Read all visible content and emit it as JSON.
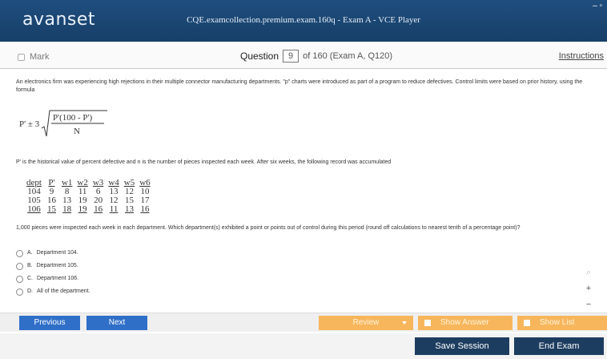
{
  "app": {
    "logo": "avanset",
    "window_title": "CQE.examcollection.premium.exam.160q - Exam A - VCE Player",
    "window_controls": "– ▫"
  },
  "header": {
    "mark_label": "Mark",
    "question_word": "Question",
    "question_number": "9",
    "of_text": "of 160 (Exam A, Q120)",
    "instructions_label": "Instructions"
  },
  "question": {
    "intro": "An electronics firm was experiencing high rejections in their multiple connector manufacturing departments. \"p\" charts were introduced as part of a program to reduce defectives. Control limits were based on prior history, using the formula",
    "formula_lhs": "P' ± 3",
    "formula_num": "P'(100 - P')",
    "formula_den": "N",
    "explain": "P' is the historical value of percent defective and n is the number of pieces inspected each week. After six weeks, the following record was accumulated",
    "table": {
      "headers": [
        "dept",
        "P'",
        "w1",
        "w2",
        "w3",
        "w4",
        "w5",
        "w6"
      ],
      "rows": [
        [
          "104",
          "9",
          "8",
          "11",
          "6",
          "13",
          "12",
          "10"
        ],
        [
          "105",
          "16",
          "13",
          "19",
          "20",
          "12",
          "15",
          "17"
        ],
        [
          "106",
          "15",
          "18",
          "19",
          "16",
          "11",
          "13",
          "16"
        ]
      ]
    },
    "prompt": "1,000 pieces were inspected each week in each department. Which department(s) exhibited a point or points out of control during this period (round off calculations to nearest tenth of a percentage point)?",
    "options": [
      {
        "letter": "A.",
        "text": "Department 104."
      },
      {
        "letter": "B.",
        "text": "Department 105."
      },
      {
        "letter": "C.",
        "text": "Department 106."
      },
      {
        "letter": "D.",
        "text": "All of the department."
      }
    ]
  },
  "zoom": {
    "search": "⌕",
    "plus": "+",
    "minus": "−"
  },
  "nav": {
    "previous": "Previous",
    "next": "Next",
    "review": "Review",
    "show_answer": "Show Answer",
    "show_list": "Show List"
  },
  "actions": {
    "save_session": "Save Session",
    "end_exam": "End Exam"
  },
  "colors": {
    "titlebar": "#1f4e7e",
    "nav_blue": "#2f6fc8",
    "nav_orange": "#f7b65c",
    "action_dark": "#1d3d60"
  }
}
